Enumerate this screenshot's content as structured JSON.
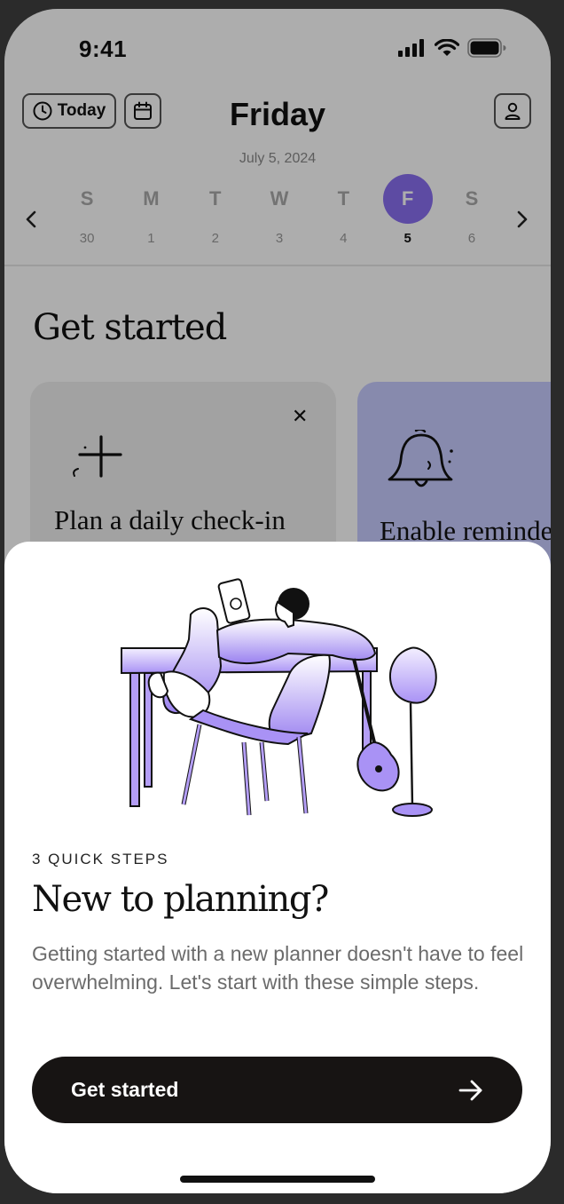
{
  "status_bar": {
    "time": "9:41",
    "icons": [
      "cellular-icon",
      "wifi-icon",
      "battery-icon"
    ]
  },
  "header": {
    "today_label": "Today",
    "day_title": "Friday",
    "date": "July 5, 2024",
    "week": [
      {
        "letter": "S",
        "num": "30",
        "selected": false
      },
      {
        "letter": "M",
        "num": "1",
        "selected": false
      },
      {
        "letter": "T",
        "num": "2",
        "selected": false
      },
      {
        "letter": "W",
        "num": "3",
        "selected": false
      },
      {
        "letter": "T",
        "num": "4",
        "selected": false
      },
      {
        "letter": "F",
        "num": "5",
        "selected": true
      },
      {
        "letter": "S",
        "num": "6",
        "selected": false
      }
    ],
    "accent": "#8a6ff0"
  },
  "content": {
    "section_title": "Get started",
    "cards": [
      {
        "label": "Plan a daily check-in",
        "icon": "plus-icon",
        "color": "#efefef"
      },
      {
        "label": "Enable reminders",
        "icon": "bell-icon",
        "color": "#c7ccff"
      }
    ],
    "close_icon": "close-icon"
  },
  "sheet": {
    "eyebrow": "3 QUICK STEPS",
    "title": "New to planning?",
    "body": "Getting started with a new planner doesn't have to feel overwhelming. Let's start with these simple steps.",
    "cta_label": "Get started",
    "cta_icon": "arrow-right-icon",
    "cta_color": "#171413"
  }
}
